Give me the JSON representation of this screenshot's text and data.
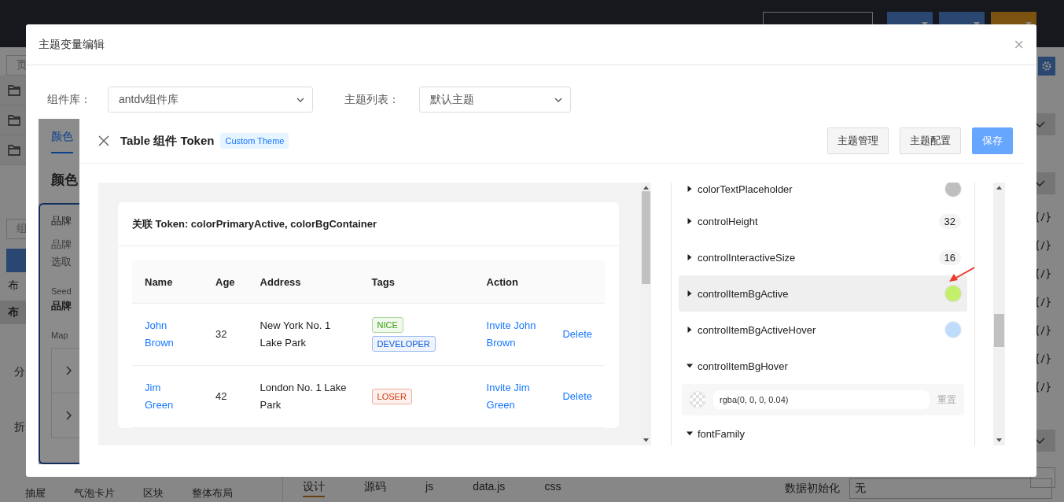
{
  "app_bar": {
    "buttons": [
      {
        "kind": "primary"
      },
      {
        "kind": "primary"
      },
      {
        "kind": "warning"
      }
    ]
  },
  "left_panel": {
    "search": {
      "placeholder": "页"
    },
    "component_search": {
      "placeholder": "组"
    },
    "tab": "布",
    "section": "布",
    "groups": [
      "分",
      "折"
    ]
  },
  "component_palette": [
    "抽屉",
    "气泡卡片",
    "区块",
    "整体布局"
  ],
  "editor_tabs": [
    {
      "label": "设计",
      "selected": true
    },
    {
      "label": "源码",
      "selected": false
    },
    {
      "label": "js",
      "selected": false
    },
    {
      "label": "data.js",
      "selected": false
    },
    {
      "label": "css",
      "selected": false
    }
  ],
  "right_panel": {
    "data_init": {
      "label": "数据初始化",
      "value": "无"
    }
  },
  "dialog": {
    "title": "主题变量编辑",
    "close": "×",
    "fields": [
      {
        "label": "组件库：",
        "value": "antdv组件库"
      },
      {
        "label": "主题列表：",
        "value": "默认主题"
      }
    ],
    "background_page": {
      "tab": {
        "label": "颜色",
        "selected": true
      },
      "heading": "颜色",
      "card": {
        "title": "品牌",
        "description": [
          "品牌",
          "选取"
        ],
        "seed_label": "Seed",
        "seed_value": "品牌",
        "map_label": "Map"
      }
    },
    "drawer": {
      "title": "Table 组件 Token",
      "tag": "Custom Theme",
      "buttons": [
        {
          "label": "主题管理",
          "kind": "default"
        },
        {
          "label": "主题配置",
          "kind": "default"
        },
        {
          "label": "保存",
          "kind": "primary"
        }
      ],
      "preview": {
        "related_tokens": "关联 Token: colorPrimaryActive, colorBgContainer",
        "columns": [
          "Name",
          "Age",
          "Address",
          "Tags",
          "Action"
        ],
        "rows": [
          {
            "name": "John Brown",
            "age": "32",
            "address": "New York No. 1 Lake Park",
            "tags": [
              {
                "label": "NICE",
                "color": "#389e0d"
              },
              {
                "label": "DEVELOPER",
                "color": "#0958d9"
              }
            ],
            "invite": "Invite John Brown",
            "delete": "Delete"
          },
          {
            "name": "Jim Green",
            "age": "42",
            "address": "London No. 1 Lake Park",
            "tags": [
              {
                "label": "LOSER",
                "color": "#d4380d"
              }
            ],
            "invite": "Invite Jim Green",
            "delete": "Delete"
          }
        ]
      },
      "tokens": [
        {
          "name": "colorTextPlaceholder",
          "kind": "color",
          "color": "#bfbfbf",
          "expanded": false,
          "selected": false
        },
        {
          "name": "controlHeight",
          "kind": "number",
          "value": "32",
          "expanded": false,
          "selected": false
        },
        {
          "name": "controlInteractiveSize",
          "kind": "number",
          "value": "16",
          "expanded": false,
          "selected": false
        },
        {
          "name": "controlItemBgActive",
          "kind": "color",
          "color": "#c3ef6a",
          "expanded": false,
          "selected": true
        },
        {
          "name": "controlItemBgActiveHover",
          "kind": "color",
          "color": "#bfdcfd",
          "expanded": false,
          "selected": false
        },
        {
          "name": "controlItemBgHover",
          "kind": "color",
          "expanded": true,
          "selected": false,
          "value": "rgba(0, 0, 0, 0.04)",
          "reset": "重置"
        },
        {
          "name": "fontFamily",
          "kind": "text",
          "expanded": true,
          "selected": false
        }
      ]
    }
  }
}
